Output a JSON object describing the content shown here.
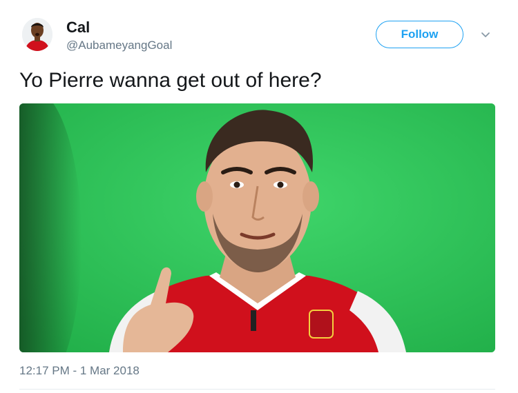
{
  "user": {
    "display_name": "Cal",
    "handle": "@AubameyangGoal"
  },
  "follow_button": {
    "label": "Follow"
  },
  "menu": {
    "icon": "chevron-down-icon"
  },
  "tweet": {
    "text": "Yo Pierre wanna get out of here?",
    "timestamp": "12:17 PM - 1 Mar 2018"
  },
  "colors": {
    "accent": "#1da1f2",
    "secondary_text": "#657786",
    "primary_text": "#14171a",
    "green_screen": "#2fc25a",
    "jersey_red": "#d0101c"
  }
}
